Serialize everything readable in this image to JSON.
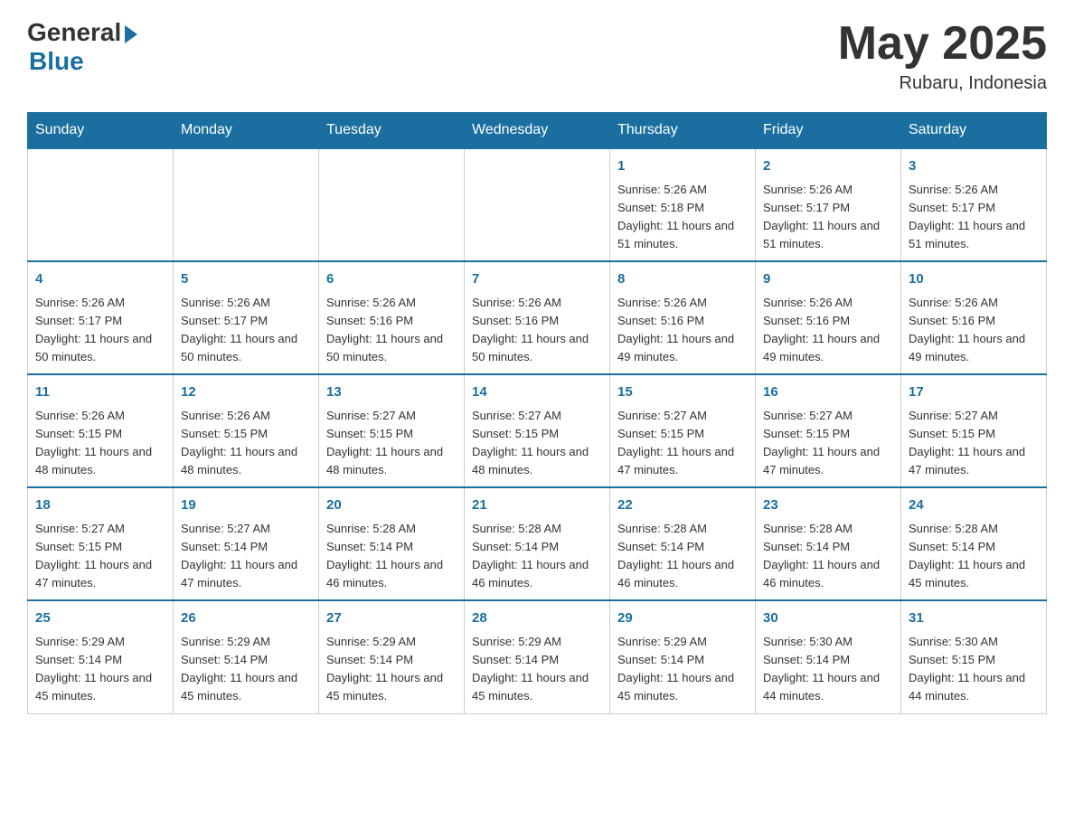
{
  "header": {
    "logo_general": "General",
    "logo_blue": "Blue",
    "month_title": "May 2025",
    "location": "Rubaru, Indonesia"
  },
  "days_of_week": [
    "Sunday",
    "Monday",
    "Tuesday",
    "Wednesday",
    "Thursday",
    "Friday",
    "Saturday"
  ],
  "weeks": [
    [
      {
        "day": "",
        "info": ""
      },
      {
        "day": "",
        "info": ""
      },
      {
        "day": "",
        "info": ""
      },
      {
        "day": "",
        "info": ""
      },
      {
        "day": "1",
        "info": "Sunrise: 5:26 AM\nSunset: 5:18 PM\nDaylight: 11 hours and 51 minutes."
      },
      {
        "day": "2",
        "info": "Sunrise: 5:26 AM\nSunset: 5:17 PM\nDaylight: 11 hours and 51 minutes."
      },
      {
        "day": "3",
        "info": "Sunrise: 5:26 AM\nSunset: 5:17 PM\nDaylight: 11 hours and 51 minutes."
      }
    ],
    [
      {
        "day": "4",
        "info": "Sunrise: 5:26 AM\nSunset: 5:17 PM\nDaylight: 11 hours and 50 minutes."
      },
      {
        "day": "5",
        "info": "Sunrise: 5:26 AM\nSunset: 5:17 PM\nDaylight: 11 hours and 50 minutes."
      },
      {
        "day": "6",
        "info": "Sunrise: 5:26 AM\nSunset: 5:16 PM\nDaylight: 11 hours and 50 minutes."
      },
      {
        "day": "7",
        "info": "Sunrise: 5:26 AM\nSunset: 5:16 PM\nDaylight: 11 hours and 50 minutes."
      },
      {
        "day": "8",
        "info": "Sunrise: 5:26 AM\nSunset: 5:16 PM\nDaylight: 11 hours and 49 minutes."
      },
      {
        "day": "9",
        "info": "Sunrise: 5:26 AM\nSunset: 5:16 PM\nDaylight: 11 hours and 49 minutes."
      },
      {
        "day": "10",
        "info": "Sunrise: 5:26 AM\nSunset: 5:16 PM\nDaylight: 11 hours and 49 minutes."
      }
    ],
    [
      {
        "day": "11",
        "info": "Sunrise: 5:26 AM\nSunset: 5:15 PM\nDaylight: 11 hours and 48 minutes."
      },
      {
        "day": "12",
        "info": "Sunrise: 5:26 AM\nSunset: 5:15 PM\nDaylight: 11 hours and 48 minutes."
      },
      {
        "day": "13",
        "info": "Sunrise: 5:27 AM\nSunset: 5:15 PM\nDaylight: 11 hours and 48 minutes."
      },
      {
        "day": "14",
        "info": "Sunrise: 5:27 AM\nSunset: 5:15 PM\nDaylight: 11 hours and 48 minutes."
      },
      {
        "day": "15",
        "info": "Sunrise: 5:27 AM\nSunset: 5:15 PM\nDaylight: 11 hours and 47 minutes."
      },
      {
        "day": "16",
        "info": "Sunrise: 5:27 AM\nSunset: 5:15 PM\nDaylight: 11 hours and 47 minutes."
      },
      {
        "day": "17",
        "info": "Sunrise: 5:27 AM\nSunset: 5:15 PM\nDaylight: 11 hours and 47 minutes."
      }
    ],
    [
      {
        "day": "18",
        "info": "Sunrise: 5:27 AM\nSunset: 5:15 PM\nDaylight: 11 hours and 47 minutes."
      },
      {
        "day": "19",
        "info": "Sunrise: 5:27 AM\nSunset: 5:14 PM\nDaylight: 11 hours and 47 minutes."
      },
      {
        "day": "20",
        "info": "Sunrise: 5:28 AM\nSunset: 5:14 PM\nDaylight: 11 hours and 46 minutes."
      },
      {
        "day": "21",
        "info": "Sunrise: 5:28 AM\nSunset: 5:14 PM\nDaylight: 11 hours and 46 minutes."
      },
      {
        "day": "22",
        "info": "Sunrise: 5:28 AM\nSunset: 5:14 PM\nDaylight: 11 hours and 46 minutes."
      },
      {
        "day": "23",
        "info": "Sunrise: 5:28 AM\nSunset: 5:14 PM\nDaylight: 11 hours and 46 minutes."
      },
      {
        "day": "24",
        "info": "Sunrise: 5:28 AM\nSunset: 5:14 PM\nDaylight: 11 hours and 45 minutes."
      }
    ],
    [
      {
        "day": "25",
        "info": "Sunrise: 5:29 AM\nSunset: 5:14 PM\nDaylight: 11 hours and 45 minutes."
      },
      {
        "day": "26",
        "info": "Sunrise: 5:29 AM\nSunset: 5:14 PM\nDaylight: 11 hours and 45 minutes."
      },
      {
        "day": "27",
        "info": "Sunrise: 5:29 AM\nSunset: 5:14 PM\nDaylight: 11 hours and 45 minutes."
      },
      {
        "day": "28",
        "info": "Sunrise: 5:29 AM\nSunset: 5:14 PM\nDaylight: 11 hours and 45 minutes."
      },
      {
        "day": "29",
        "info": "Sunrise: 5:29 AM\nSunset: 5:14 PM\nDaylight: 11 hours and 45 minutes."
      },
      {
        "day": "30",
        "info": "Sunrise: 5:30 AM\nSunset: 5:14 PM\nDaylight: 11 hours and 44 minutes."
      },
      {
        "day": "31",
        "info": "Sunrise: 5:30 AM\nSunset: 5:15 PM\nDaylight: 11 hours and 44 minutes."
      }
    ]
  ]
}
